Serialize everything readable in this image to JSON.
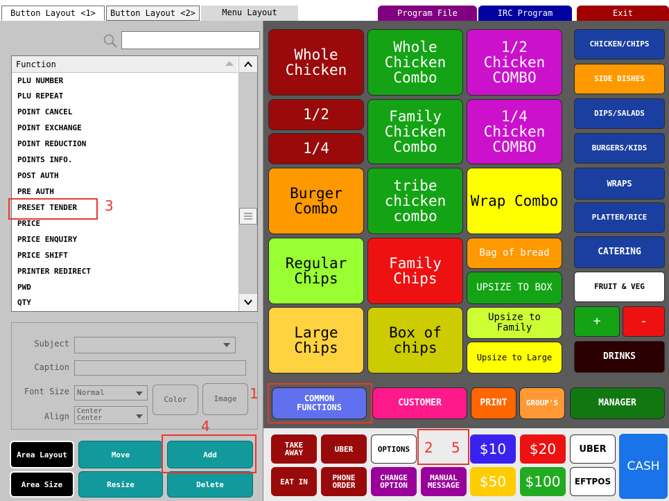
{
  "tabs": [
    {
      "label": "Button Layout <1>"
    },
    {
      "label": "Button Layout <2>"
    },
    {
      "label": "Menu Layout"
    }
  ],
  "top_buttons": [
    {
      "label": "Program File",
      "color": "#800080"
    },
    {
      "label": "IRC Program",
      "color": "#0000a0"
    },
    {
      "label": "Exit",
      "color": "#a00000"
    }
  ],
  "function_list": {
    "header": "Function",
    "rows": [
      "PLU NUMBER",
      "PLU REPEAT",
      "POINT CANCEL",
      "POINT EXCHANGE",
      "POINT REDUCTION",
      "POINTS INFO.",
      "POST AUTH",
      "PRE AUTH",
      "PRESET TENDER",
      "PRICE",
      "PRICE ENQUIRY",
      "PRICE SHIFT",
      "PRINTER REDIRECT",
      "PWD",
      "QTY"
    ]
  },
  "props": {
    "subject_label": "Subject",
    "caption_label": "Caption",
    "font_size_label": "Font Size",
    "font_size_value": "Normal",
    "align_label": "Align",
    "align_value_1": "Center",
    "align_value_2": "Center",
    "color_button": "Color",
    "image_button": "Image"
  },
  "controls": {
    "area_layout": "Area Layout",
    "move": "Move",
    "add": "Add",
    "area_size": "Area Size",
    "resize": "Resize",
    "delete": "Delete"
  },
  "menu_buttons": {
    "whole_chicken": "Whole\nChicken",
    "whole_chicken_combo": "Whole\nChicken\nCombo",
    "half_chicken_combo": "1/2\nChicken\nCOMBO",
    "half": "1/2",
    "quarter": "1/4",
    "family_chicken_combo": "Family\nChicken\nCombo",
    "quarter_chicken_combo": "1/4\nChicken\nCOMBO",
    "burger_combo": "Burger\nCombo",
    "tribe_chicken_combo": "tribe\nchicken\ncombo",
    "wrap_combo": "Wrap Combo",
    "regular_chips": "Regular\nChips",
    "family_chips": "Family\nChips",
    "bag_of_bread": "Bag of bread",
    "upsize_to_box": "UPSIZE TO BOX",
    "large_chips": "Large\nChips",
    "box_of_chips": "Box of\nchips",
    "upsize_to_family": "Upsize to\nFamily",
    "upsize_to_large": "Upsize to Large"
  },
  "categories": [
    "CHICKEN/CHIPS",
    "SIDE DISHES",
    "DIPS/SALADS",
    "BURGERS/KIDS",
    "WRAPS",
    "PLATTER/RICE",
    "CATERING",
    "FRUIT & VEG"
  ],
  "cat_extra": {
    "plus": "+",
    "minus": "-",
    "drinks": "DRINKS"
  },
  "function_row": {
    "common_functions": "COMMON\nFUNCTIONS",
    "customer": "CUSTOMER",
    "print": "PRINT",
    "groups": "GROUP'S",
    "manager": "MANAGER"
  },
  "pay_buttons": {
    "take_away": "TAKE\nAWAY",
    "uber_red": "UBER",
    "options": "OPTIONS",
    "ten": "$10",
    "twenty": "$20",
    "uber_white": "UBER",
    "cash": "CASH",
    "eat_in": "EAT IN",
    "phone_order": "PHONE\nORDER",
    "change_option": "CHANGE\nOPTION",
    "manual_message": "MANUAL\nMESSAGE",
    "fifty": "$50",
    "hundred": "$100",
    "eftpos": "EFTPOS"
  },
  "annotations": {
    "n1": "1",
    "n2": "2",
    "n3": "3",
    "n4": "4",
    "n5": "5"
  },
  "icons": {
    "search": "search-icon",
    "scroll_up": "chevron-up-icon",
    "scroll_down": "chevron-down-icon",
    "scroll_thumb": "menu-lines-icon"
  }
}
